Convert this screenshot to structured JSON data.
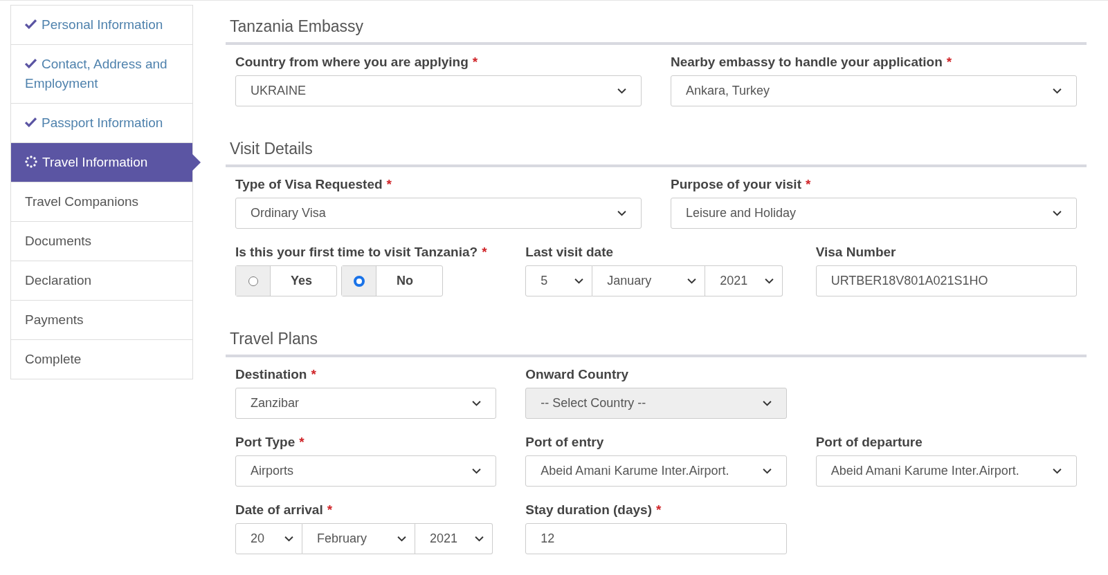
{
  "steps": [
    {
      "label": "Personal Information",
      "completed": true,
      "selected": false
    },
    {
      "label": "Contact, Address and Employment",
      "completed": true,
      "selected": false
    },
    {
      "label": "Passport Information",
      "completed": true,
      "selected": false
    },
    {
      "label": "Travel Information",
      "completed": false,
      "selected": true
    },
    {
      "label": "Travel Companions",
      "completed": false,
      "selected": false
    },
    {
      "label": "Documents",
      "completed": false,
      "selected": false
    },
    {
      "label": "Declaration",
      "completed": false,
      "selected": false
    },
    {
      "label": "Payments",
      "completed": false,
      "selected": false
    },
    {
      "label": "Complete",
      "completed": false,
      "selected": false
    }
  ],
  "sections": [
    {
      "title": "Tanzania Embassy",
      "rows": [
        {
          "kind": "halves",
          "fields": [
            {
              "kind": "select",
              "label": "Country from where you are applying",
              "required": "*",
              "value": "UKRAINE",
              "disabled": false
            },
            {
              "kind": "select",
              "label": "Nearby embassy to handle your application",
              "required": "*",
              "value": "Ankara, Turkey",
              "disabled": false
            }
          ]
        }
      ]
    },
    {
      "title": "Visit Details",
      "rows": [
        {
          "kind": "halves",
          "fields": [
            {
              "kind": "select",
              "label": "Type of Visa Requested",
              "required": "*",
              "value": "Ordinary Visa",
              "disabled": false
            },
            {
              "kind": "select",
              "label": "Purpose of your visit",
              "required": "*",
              "value": "Leisure and Holiday",
              "disabled": false
            }
          ]
        },
        {
          "kind": "thirds",
          "fields": [
            {
              "kind": "radio",
              "label": "Is this your first time to visit Tanzania?",
              "required": "*",
              "options": [
                {
                  "label": "Yes",
                  "selected": false
                },
                {
                  "label": "No",
                  "selected": true
                }
              ]
            },
            {
              "kind": "date",
              "label": "Last visit date",
              "day": "5",
              "month": "January",
              "year": "2021"
            },
            {
              "kind": "text",
              "label": "Visa Number",
              "value": "URTBER18V801A021S1HO"
            }
          ]
        }
      ]
    },
    {
      "title": "Travel Plans",
      "rows": [
        {
          "kind": "thirds",
          "fields": [
            {
              "kind": "select",
              "label": "Destination",
              "required": "*",
              "value": "Zanzibar",
              "disabled": false
            },
            {
              "kind": "select",
              "label": "Onward Country",
              "value": "-- Select Country --",
              "disabled": true
            }
          ]
        },
        {
          "kind": "thirds",
          "fields": [
            {
              "kind": "select",
              "label": "Port Type",
              "required": "*",
              "value": "Airports",
              "disabled": false
            },
            {
              "kind": "select",
              "label": "Port of entry",
              "value": "Abeid Amani Karume Inter.Airport.",
              "disabled": false
            },
            {
              "kind": "select",
              "label": "Port of departure",
              "value": "Abeid Amani Karume Inter.Airport.",
              "disabled": false
            }
          ]
        },
        {
          "kind": "thirds",
          "fields": [
            {
              "kind": "date",
              "label": "Date of arrival",
              "required": "*",
              "day": "20",
              "month": "February",
              "year": "2021"
            },
            {
              "kind": "text",
              "label": "Stay duration (days)",
              "required": "*",
              "value": "12"
            }
          ]
        }
      ]
    }
  ]
}
